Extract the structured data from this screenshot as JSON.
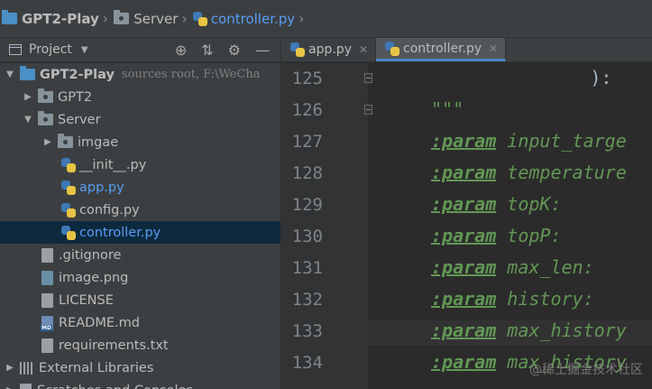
{
  "breadcrumb": {
    "items": [
      "GPT2-Play",
      "Server",
      "controller.py"
    ]
  },
  "project_panel": {
    "title": "Project",
    "tree": [
      {
        "label": "GPT2-Play",
        "meta": "sources root,  F:\\WeCha",
        "indent": 0,
        "arrow": "down",
        "icon": "folder-blue",
        "bold": true
      },
      {
        "label": "GPT2",
        "indent": 1,
        "arrow": "right",
        "icon": "folder"
      },
      {
        "label": "Server",
        "indent": 1,
        "arrow": "down",
        "icon": "folder"
      },
      {
        "label": "imgae",
        "indent": 2,
        "arrow": "right",
        "icon": "folder"
      },
      {
        "label": "__init__.py",
        "indent": 3,
        "icon": "python"
      },
      {
        "label": "app.py",
        "indent": 3,
        "icon": "python",
        "highlight": true
      },
      {
        "label": "config.py",
        "indent": 3,
        "icon": "python"
      },
      {
        "label": "controller.py",
        "indent": 3,
        "icon": "python",
        "highlight": true,
        "selected": true
      },
      {
        "label": ".gitignore",
        "indent": 2,
        "icon": "file"
      },
      {
        "label": "image.png",
        "indent": 2,
        "icon": "image"
      },
      {
        "label": "LICENSE",
        "indent": 2,
        "icon": "file"
      },
      {
        "label": "README.md",
        "indent": 2,
        "icon": "markdown"
      },
      {
        "label": "requirements.txt",
        "indent": 2,
        "icon": "file"
      },
      {
        "label": "External Libraries",
        "indent": 0,
        "arrow": "right",
        "icon": "library"
      },
      {
        "label": "Scratches and Consoles",
        "indent": 0,
        "arrow": "right",
        "icon": "scratch"
      }
    ]
  },
  "tabs": [
    {
      "label": "app.py",
      "active": false
    },
    {
      "label": "controller.py",
      "active": true
    }
  ],
  "editor": {
    "lines": [
      {
        "num": "125",
        "text": "        ):"
      },
      {
        "num": "126",
        "text": "\"\"\""
      },
      {
        "num": "127",
        "tag": ":param",
        "param": "input_targe"
      },
      {
        "num": "128",
        "tag": ":param",
        "param": "temperature"
      },
      {
        "num": "129",
        "tag": ":param",
        "param": "topK:"
      },
      {
        "num": "130",
        "tag": ":param",
        "param": "topP:"
      },
      {
        "num": "131",
        "tag": ":param",
        "param": "max_len:"
      },
      {
        "num": "132",
        "tag": ":param",
        "param": "history:"
      },
      {
        "num": "133",
        "tag": ":param",
        "param": "max_history"
      },
      {
        "num": "134",
        "tag": ":param",
        "param": "max_history"
      }
    ]
  },
  "watermark": "@稀土掘金技术社区",
  "colors": {
    "panel_bg": "#3c3f41",
    "editor_bg": "#2b2b2b",
    "doc_green": "#629755",
    "selection": "#0d293e",
    "link_blue": "#589df6"
  }
}
